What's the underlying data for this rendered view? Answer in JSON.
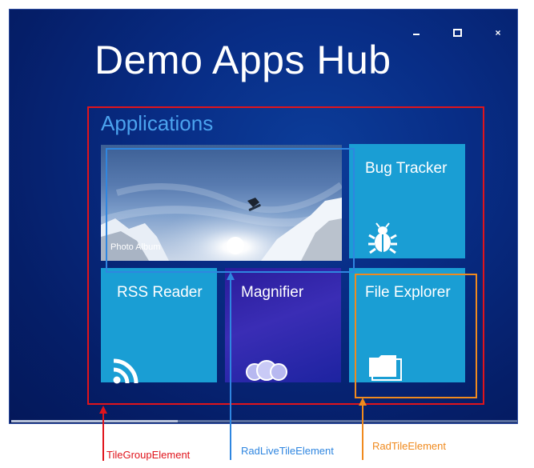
{
  "window": {
    "minimize_icon": "minimize-icon",
    "maximize_icon": "maximize-icon",
    "close_glyph": "×",
    "close_icon": "close-icon"
  },
  "app": {
    "title": "Demo Apps Hub"
  },
  "group": {
    "label": "Applications"
  },
  "tiles": {
    "photo_album": {
      "label": "Photo Album"
    },
    "bug_tracker": {
      "label": "Bug Tracker",
      "icon": "bug-icon"
    },
    "rss_reader": {
      "label": "RSS Reader",
      "icon": "rss-icon"
    },
    "magnifier": {
      "label": "Magnifier",
      "icon": "magnifier-icon"
    },
    "file_explorer": {
      "label": "File Explorer",
      "icon": "folder-icon"
    }
  },
  "annotations": {
    "tile_group": {
      "label": "TileGroupElement",
      "color": "#e0141c"
    },
    "live_tile": {
      "label": "RadLiveTileElement",
      "color": "#2f86e0"
    },
    "rad_tile": {
      "label": "RadTileElement",
      "color": "#f08a1e"
    }
  },
  "colors": {
    "tile_blue": "#1a9ed4",
    "tile_purple": "#2a1c9a",
    "background_navy": "#082d86",
    "group_label": "#4ba3ee"
  },
  "scrollbar": {
    "position_fraction": 0.0
  }
}
